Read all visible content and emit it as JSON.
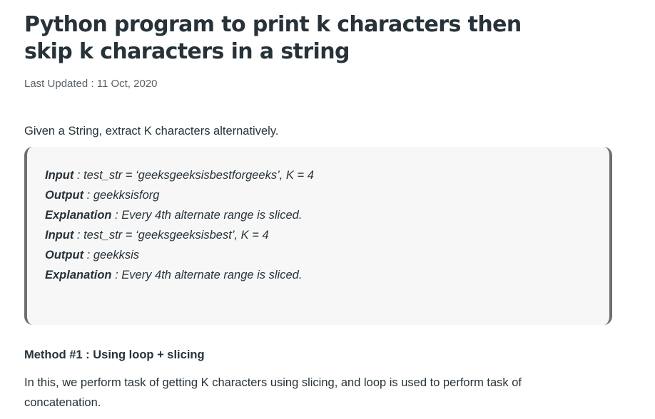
{
  "article": {
    "title": "Python program to print k characters then skip k characters in a string",
    "last_updated": "Last Updated : 11 Oct, 2020",
    "intro": "Given a String, extract K characters alternatively.",
    "examples": [
      {
        "key": "Input",
        "value": " : test_str = ‘geeksgeeksisbestforgeeks’, K = 4"
      },
      {
        "key": "Output",
        "value": " : geekksisforg"
      },
      {
        "key": "Explanation",
        "value": " : Every 4th alternate range is sliced."
      },
      {
        "key": "Input",
        "value": " : test_str = ‘geeksgeeksisbest’, K = 4"
      },
      {
        "key": "Output",
        "value": " : geekksis"
      },
      {
        "key": "Explanation",
        "value": " : Every 4th alternate range is sliced."
      }
    ],
    "method_heading": "Method #1 : Using loop + slicing",
    "method_description": "In this, we perform task of getting K characters using slicing, and loop is used to perform task of concatenation."
  }
}
